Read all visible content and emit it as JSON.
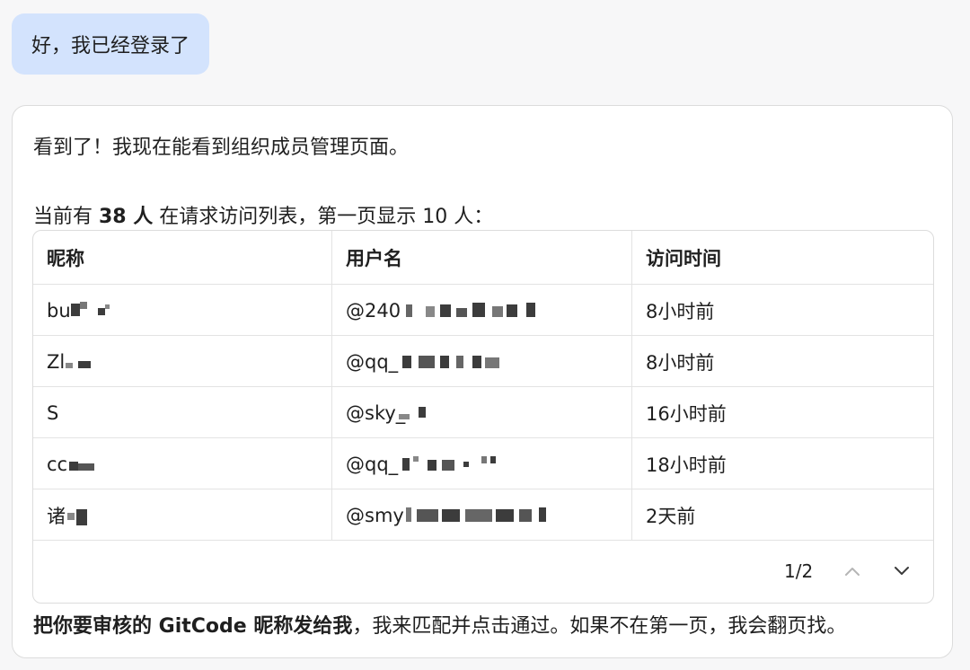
{
  "user_message": "好，我已经登录了",
  "assistant": {
    "line1": "看到了！我现在能看到组织成员管理页面。",
    "line2_prefix": "当前有 ",
    "line2_count": "38 人",
    "line2_suffix": " 在请求访问列表，第一页显示 10 人：",
    "line3_bold": "把你要审核的 GitCode 昵称发给我",
    "line3_rest": "，我来匹配并点击通过。如果不在第一页，我会翻页找。"
  },
  "table": {
    "headers": [
      "昵称",
      "用户名",
      "访问时间"
    ],
    "rows": [
      {
        "nickname": "bu",
        "username": "@240",
        "time": "8小时前"
      },
      {
        "nickname": "Zl",
        "username": "@qq_",
        "time": "8小时前"
      },
      {
        "nickname": "S",
        "username": "@sky_",
        "time": "16小时前"
      },
      {
        "nickname": "cc",
        "username": "@qq_",
        "time": "18小时前"
      },
      {
        "nickname": "诸",
        "username": "@smy",
        "time": "2天前"
      }
    ]
  },
  "pager": {
    "indicator": "1/2",
    "prev_icon": "chevron-up-icon",
    "next_icon": "chevron-down-icon"
  }
}
